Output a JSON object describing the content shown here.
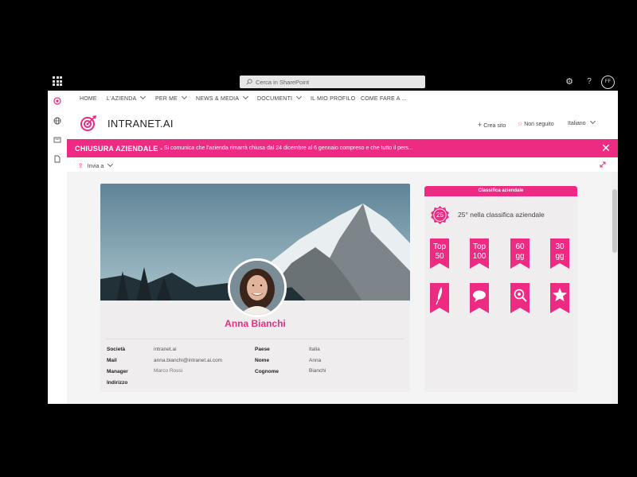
{
  "suite": {
    "search_placeholder": "Cerca in SharePoint",
    "user_initials": "FF"
  },
  "nav": {
    "items": [
      {
        "label": "HOME",
        "dropdown": false
      },
      {
        "label": "L'AZIENDA",
        "dropdown": true
      },
      {
        "label": "PER ME",
        "dropdown": true
      },
      {
        "label": "NEWS & MEDIA",
        "dropdown": true
      },
      {
        "label": "DOCUMENTI",
        "dropdown": true
      },
      {
        "label": "IL MIO PROFILO",
        "dropdown": false
      },
      {
        "label": "COME FARE A ...",
        "dropdown": false
      }
    ]
  },
  "site": {
    "title": "INTRANET.AI",
    "create_site": "Crea sito",
    "follow": "Non seguito",
    "language": "Italiano"
  },
  "banner": {
    "title": "CHIUSURA AZIENDALE -",
    "text": "Si comunica che l'azienda rimarrà chiusa dal 24 dicembre al 6 gennaio compreso e che tutto il pers..."
  },
  "toolbar": {
    "share": "Invia a"
  },
  "profile": {
    "name": "Anna Bianchi",
    "left_fields": [
      {
        "label": "Società",
        "value": "intranet.ai"
      },
      {
        "label": "Mail",
        "value": "anna.bianchi@intranet.ai.com"
      },
      {
        "label": "Manager",
        "value": "Marco Rossi"
      },
      {
        "label": "Indirizzo",
        "value": ""
      }
    ],
    "right_fields": [
      {
        "label": "Paese",
        "value": "Italia"
      },
      {
        "label": "Nome",
        "value": "Anna"
      },
      {
        "label": "Cognome",
        "value": "Bianchi"
      }
    ]
  },
  "ranking": {
    "title": "Classifica aziendale",
    "position": "25",
    "text": "25° nella classifica aziendale",
    "badges_row1": [
      {
        "line1": "Top",
        "line2": "50"
      },
      {
        "line1": "Top",
        "line2": "100"
      },
      {
        "line1": "60",
        "line2": "gg"
      },
      {
        "line1": "30",
        "line2": "gg"
      }
    ],
    "badges_row2_icons": [
      "feather-icon",
      "speech-bubble-icon",
      "magnifier-icon",
      "star-icon"
    ]
  },
  "colors": {
    "accent": "#ED2B82",
    "suite_bar": "#000000",
    "card_bg": "#EFEDEE"
  }
}
